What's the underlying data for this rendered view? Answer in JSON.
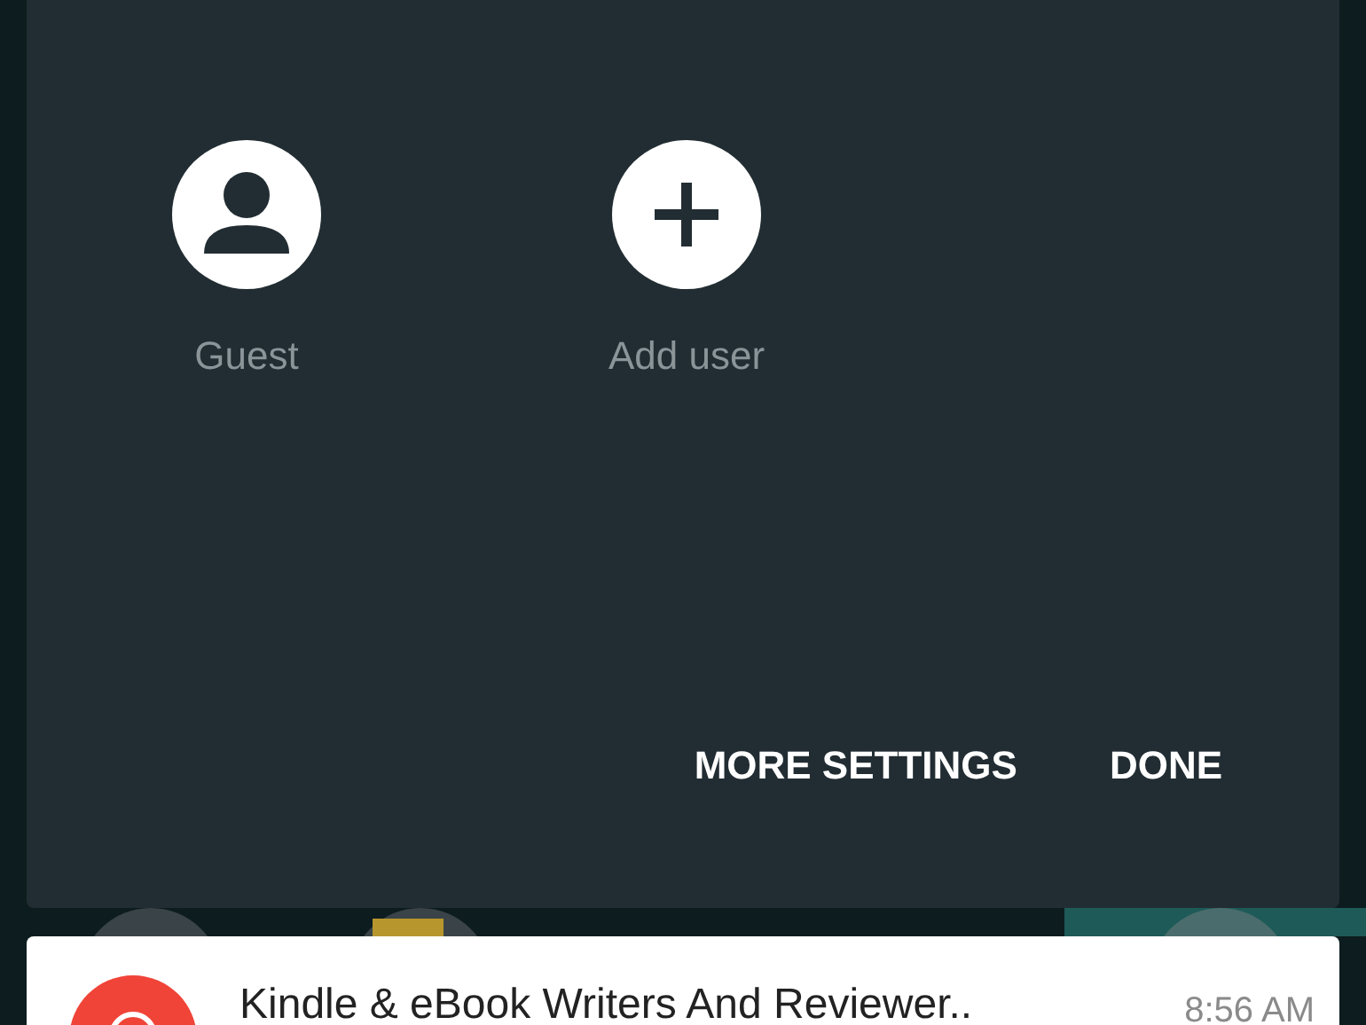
{
  "users": [
    {
      "name": "Guest",
      "kind": "guest",
      "selected": false
    },
    {
      "name": "Add user",
      "kind": "add",
      "selected": false
    }
  ],
  "buttons": [
    "MORE SETTINGS",
    "DONE"
  ],
  "notification": {
    "title": "Kindle & eBook Writers And Reviewer..",
    "time": "8:56 AM"
  }
}
